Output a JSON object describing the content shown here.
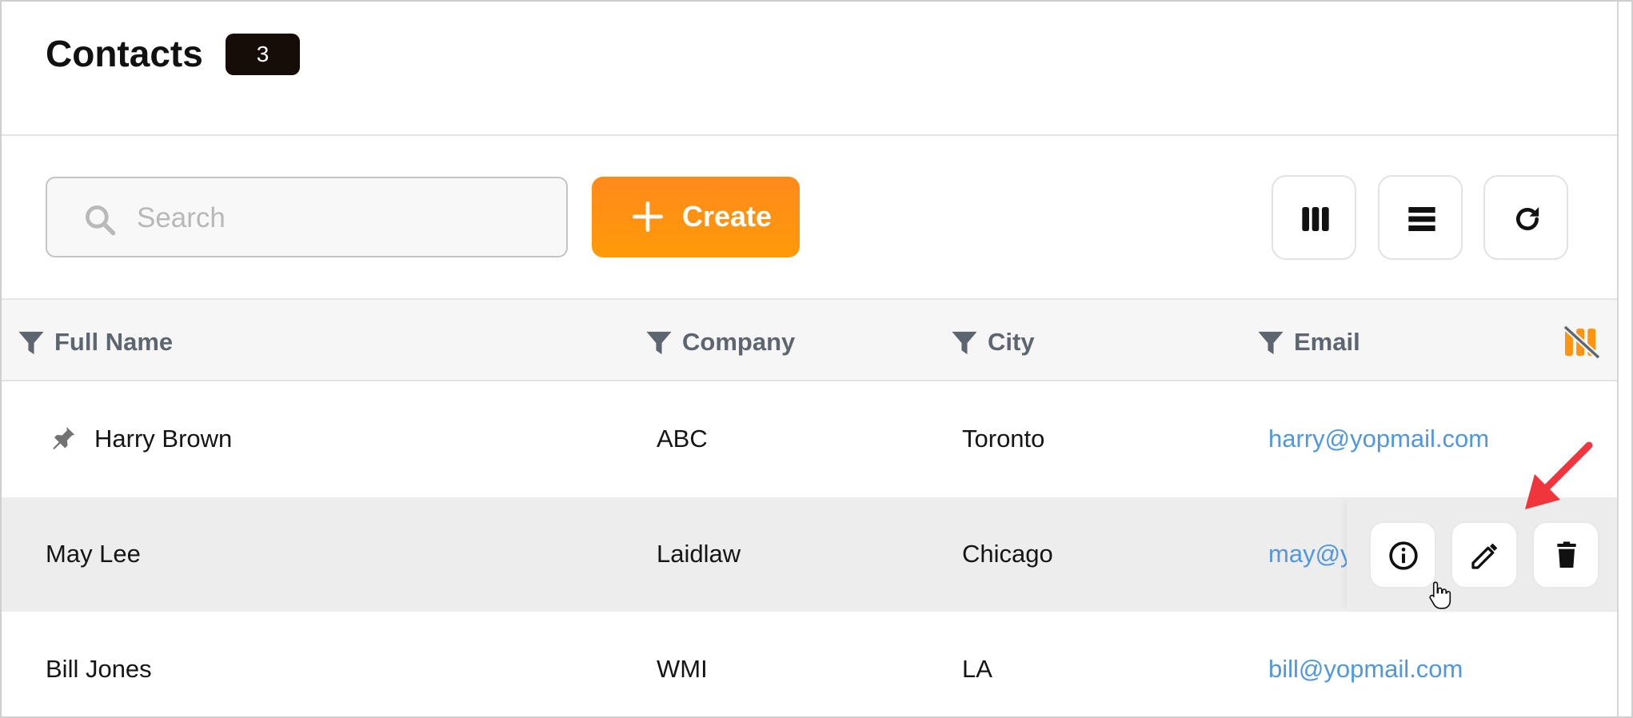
{
  "header": {
    "title": "Contacts",
    "count": "3"
  },
  "toolbar": {
    "search_placeholder": "Search",
    "search_value": "",
    "create_label": "Create",
    "icons": {
      "search": "search-icon",
      "create": "plus-icon",
      "columns": "columns-icon",
      "density": "list-density-icon",
      "refresh": "refresh-icon"
    }
  },
  "table": {
    "columns": [
      {
        "label": "Full Name",
        "icon": "filter-icon"
      },
      {
        "label": "Company",
        "icon": "filter-icon"
      },
      {
        "label": "City",
        "icon": "filter-icon"
      },
      {
        "label": "Email",
        "icon": "filter-icon"
      }
    ],
    "rows": [
      {
        "full_name": "Harry Brown",
        "company": "ABC",
        "city": "Toronto",
        "email": "harry@yopmail.com",
        "pinned": true
      },
      {
        "full_name": "May Lee",
        "company": "Laidlaw",
        "city": "Chicago",
        "email": "may@y",
        "pinned": false,
        "hovered": true
      },
      {
        "full_name": "Bill Jones",
        "company": "WMI",
        "city": "LA",
        "email": "bill@yopmail.com",
        "pinned": false
      }
    ],
    "row_actions": [
      "info-icon",
      "edit-icon",
      "delete-icon"
    ]
  },
  "colors": {
    "accent_orange": "#ff9410",
    "link_blue": "#4f97e3",
    "header_text": "#5d6670",
    "badge_bg": "#160d09",
    "annotation_arrow": "#f0353d"
  }
}
